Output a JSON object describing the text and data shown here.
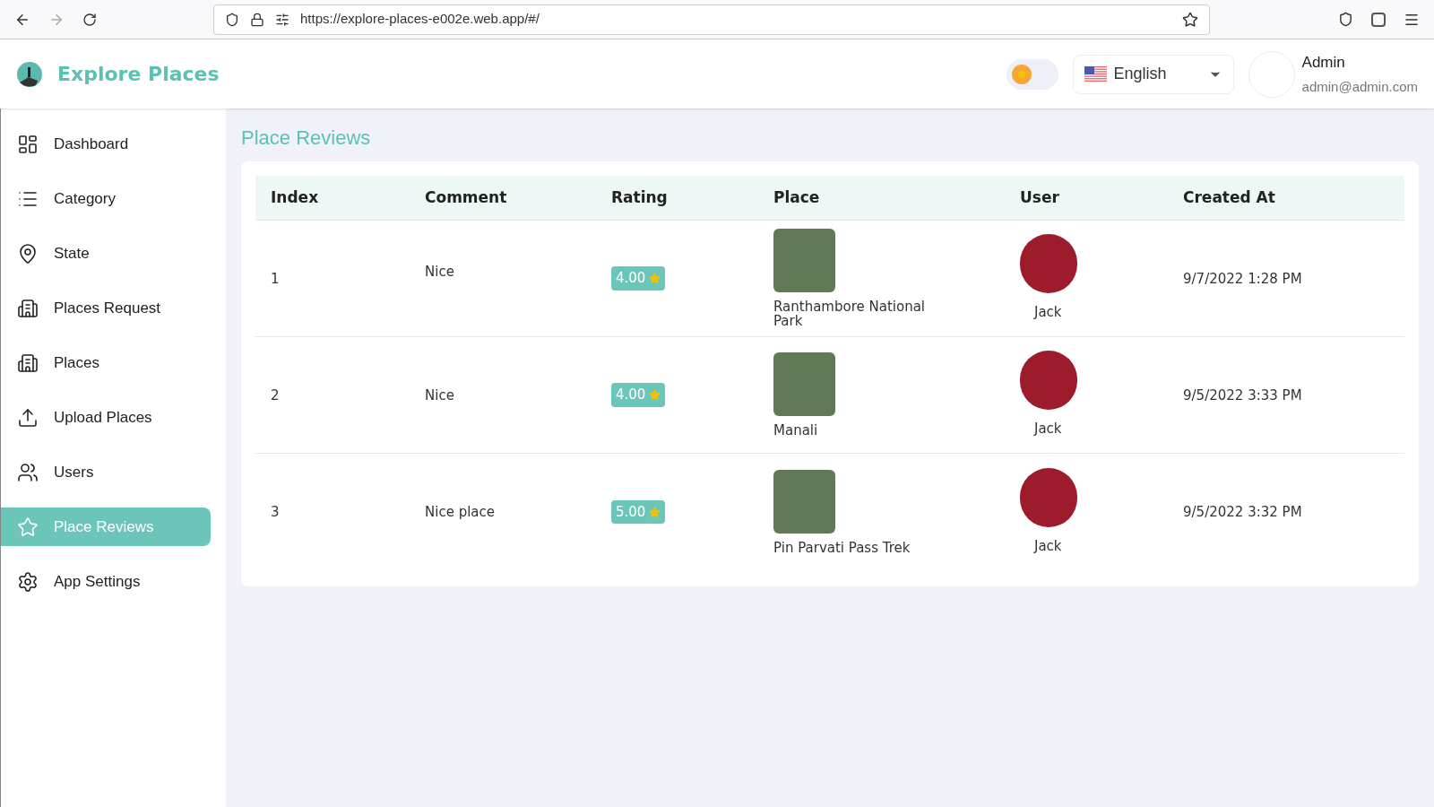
{
  "browser": {
    "url": "https://explore-places-e002e.web.app/#/"
  },
  "header": {
    "app_name": "Explore Places",
    "dark_mode": false,
    "language": "English",
    "user_name": "Admin",
    "user_email": "admin@admin.com"
  },
  "sidebar": {
    "items": [
      {
        "label": "Dashboard",
        "selected": false
      },
      {
        "label": "Category",
        "selected": false
      },
      {
        "label": "State",
        "selected": false
      },
      {
        "label": "Places Request",
        "selected": false
      },
      {
        "label": "Places",
        "selected": false
      },
      {
        "label": "Upload Places",
        "selected": false
      },
      {
        "label": "Users",
        "selected": false
      },
      {
        "label": "Place Reviews",
        "selected": true
      },
      {
        "label": "App Settings",
        "selected": false
      }
    ]
  },
  "page_title": "Place Reviews",
  "table": {
    "columns": [
      "Index",
      "Comment",
      "Rating",
      "Place",
      "User",
      "Created At"
    ],
    "rows": [
      {
        "index": "1",
        "comment": "Nice",
        "rating": "4.00",
        "place": "Ranthambore National Park",
        "user": "Jack",
        "created_at": "9/7/2022 1:28 PM"
      },
      {
        "index": "2",
        "comment": "Nice",
        "rating": "4.00",
        "place": "Manali",
        "user": "Jack",
        "created_at": "9/5/2022 3:33 PM"
      },
      {
        "index": "3",
        "comment": "Nice place",
        "rating": "5.00",
        "place": "Pin Parvati Pass Trek",
        "user": "Jack",
        "created_at": "9/5/2022 3:32 PM"
      }
    ]
  }
}
